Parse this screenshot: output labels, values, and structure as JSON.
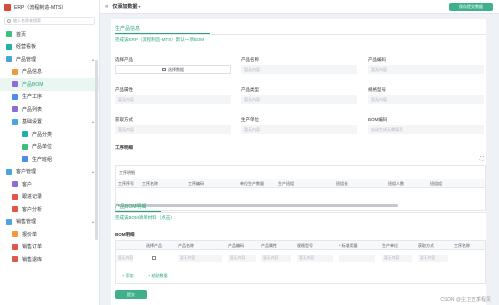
{
  "app": {
    "title": "ERP（流程制造-MTS）"
  },
  "search": {
    "placeholder": "输入名称来搜索"
  },
  "sidebar": {
    "items": [
      {
        "label": "首页",
        "icon": "home-icon",
        "level": 1,
        "color": "#3cbf7e"
      },
      {
        "label": "经营看板",
        "icon": "dashboard-icon",
        "level": 1,
        "color": "#1eb2a6"
      },
      {
        "label": "产品管理",
        "icon": "folder-icon",
        "level": 1,
        "color": "#4ba3e0",
        "expanded": true
      },
      {
        "label": "产品信息",
        "icon": "box-icon",
        "level": 2,
        "color": "#f09a3e"
      },
      {
        "label": "产品BOM",
        "icon": "bom-icon",
        "level": 2,
        "color": "#8d6cd8",
        "active": true
      },
      {
        "label": "生产工序",
        "icon": "process-icon",
        "level": 2,
        "color": "#4c8bf0"
      },
      {
        "label": "产品列表",
        "icon": "list-icon",
        "level": 2,
        "color": "#8d6cd8"
      },
      {
        "label": "基础设置",
        "icon": "folder-icon",
        "level": 2,
        "color": "#4ba3e0",
        "expanded": true
      },
      {
        "label": "产品分类",
        "icon": "category-icon",
        "level": 3,
        "color": "#1eb2a6"
      },
      {
        "label": "产品单位",
        "icon": "unit-icon",
        "level": 3,
        "color": "#3cbf7e"
      },
      {
        "label": "生产班组",
        "icon": "team-icon",
        "level": 3,
        "color": "#4c8bf0"
      },
      {
        "label": "客户管理",
        "icon": "folder-icon",
        "level": 1,
        "color": "#4ba3e0",
        "expanded": true
      },
      {
        "label": "客户",
        "icon": "customer-icon",
        "level": 2,
        "color": "#8d6cd8"
      },
      {
        "label": "跟进记录",
        "icon": "follow-up-icon",
        "level": 2,
        "color": "#e0574a"
      },
      {
        "label": "客户分析",
        "icon": "analysis-icon",
        "level": 2,
        "color": "#e0574a"
      },
      {
        "label": "销售管理",
        "icon": "folder-icon",
        "level": 1,
        "color": "#4ba3e0",
        "expanded": true
      },
      {
        "label": "报价单",
        "icon": "quote-icon",
        "level": 2,
        "color": "#f09a3e"
      },
      {
        "label": "销售订单",
        "icon": "order-icon",
        "level": 2,
        "color": "#e0574a"
      },
      {
        "label": "销售退库",
        "icon": "return-icon",
        "level": 2,
        "color": "#e0574a"
      }
    ]
  },
  "topbar": {
    "title": "仅添加数据",
    "submit_label": "保存提交数据"
  },
  "main": {
    "info_section": {
      "title": "生产品信息",
      "subtitle": "完成该ERP（流程制造-MTS）默认一项BOM"
    },
    "fields": {
      "select_product": {
        "label": "选择产品",
        "button": "选择数据"
      },
      "product_name": {
        "label": "产品名称",
        "placeholder": "暂无内容"
      },
      "product_code": {
        "label": "产品编码",
        "placeholder": "暂无内容"
      },
      "product_attr": {
        "label": "产品属性",
        "placeholder": "暂无内容"
      },
      "product_type": {
        "label": "产品类型",
        "placeholder": "暂无内容"
      },
      "spec_model": {
        "label": "规格型号",
        "placeholder": "暂无内容"
      },
      "acquire_method": {
        "label": "获取方式",
        "placeholder": "暂无内容"
      },
      "prod_unit": {
        "label": "生产单位",
        "placeholder": "暂无内容"
      },
      "bom_code": {
        "label": "BOM编码",
        "placeholder": "自动生成无需填写"
      }
    },
    "process_detail": {
      "title": "工序明细",
      "grid_title": "工序明细",
      "headers": [
        "工序序号",
        "工序名称",
        "工序编码",
        "单位生产数量",
        "生产班组",
        "班组长",
        "班组人数",
        "班组组"
      ]
    },
    "bom_section": {
      "title": "产品BOM明细",
      "subtitle": "完成该BOM清单材料（点击）"
    },
    "bom_detail": {
      "title": "BOM明细",
      "headers": [
        "选择产品",
        "产品名称",
        "产品编码",
        "产品属性",
        "规格型号",
        "* 标准用量",
        "生产单位",
        "获取方式",
        "工序名称"
      ],
      "rows": [
        {
          "num": "1",
          "cells": [
            "暂无内容",
            "暂无内容",
            "暂无内容",
            "暂无内容",
            "",
            "暂无内容",
            "暂无内容",
            "暂无内容"
          ]
        }
      ],
      "add_label": "+ 添加",
      "paste_label": "+ 粘贴数据"
    },
    "ok_label": "提交"
  },
  "watermark": "CSDN @尘卫五季程见"
}
